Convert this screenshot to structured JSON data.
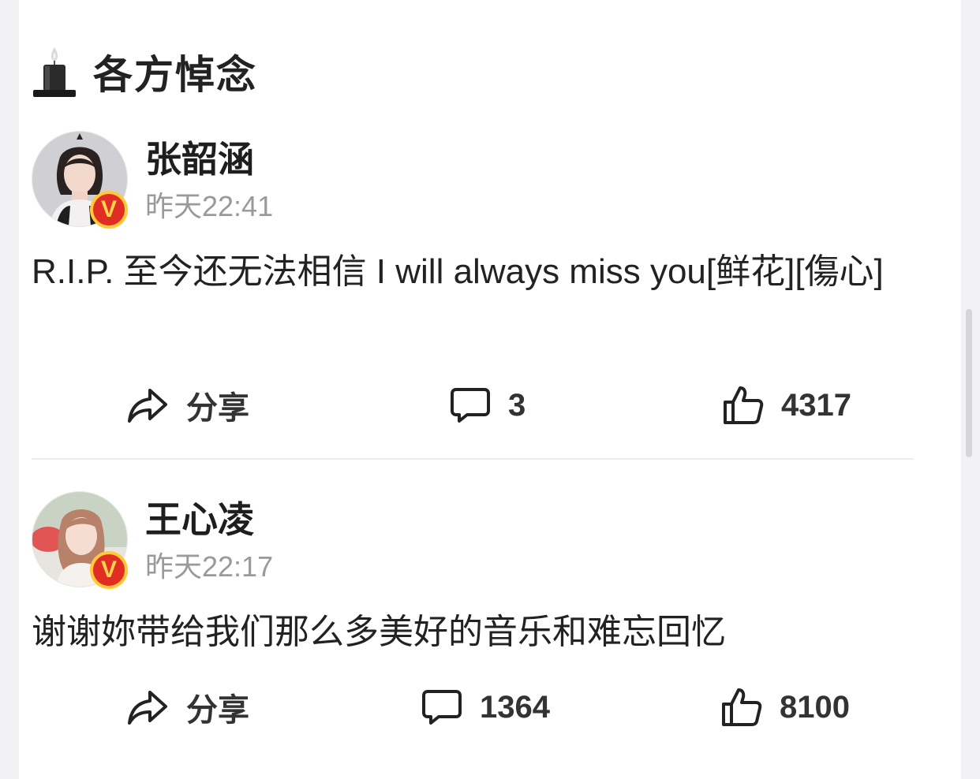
{
  "section": {
    "icon": "candle-icon",
    "title": "各方悼念"
  },
  "posts": [
    {
      "username": "张韶涵",
      "verified_badge": "V",
      "timestamp": "昨天22:41",
      "content": "R.I.P. 至今还无法相信 I will always miss you[鲜花][傷心]",
      "actions": {
        "share_label": "分享",
        "comment_count": "3",
        "like_count": "4317"
      }
    },
    {
      "username": "王心凌",
      "verified_badge": "V",
      "timestamp": "昨天22:17",
      "content": "谢谢妳带给我们那么多美好的音乐和难忘回忆",
      "actions": {
        "share_label": "分享",
        "comment_count": "1364",
        "like_count": "8100"
      }
    }
  ],
  "colors": {
    "background": "#f2f2f4",
    "card": "#ffffff",
    "verified_badge": "#e02e24",
    "verified_ring": "#ffc93a",
    "timestamp": "#9a9a9a"
  }
}
